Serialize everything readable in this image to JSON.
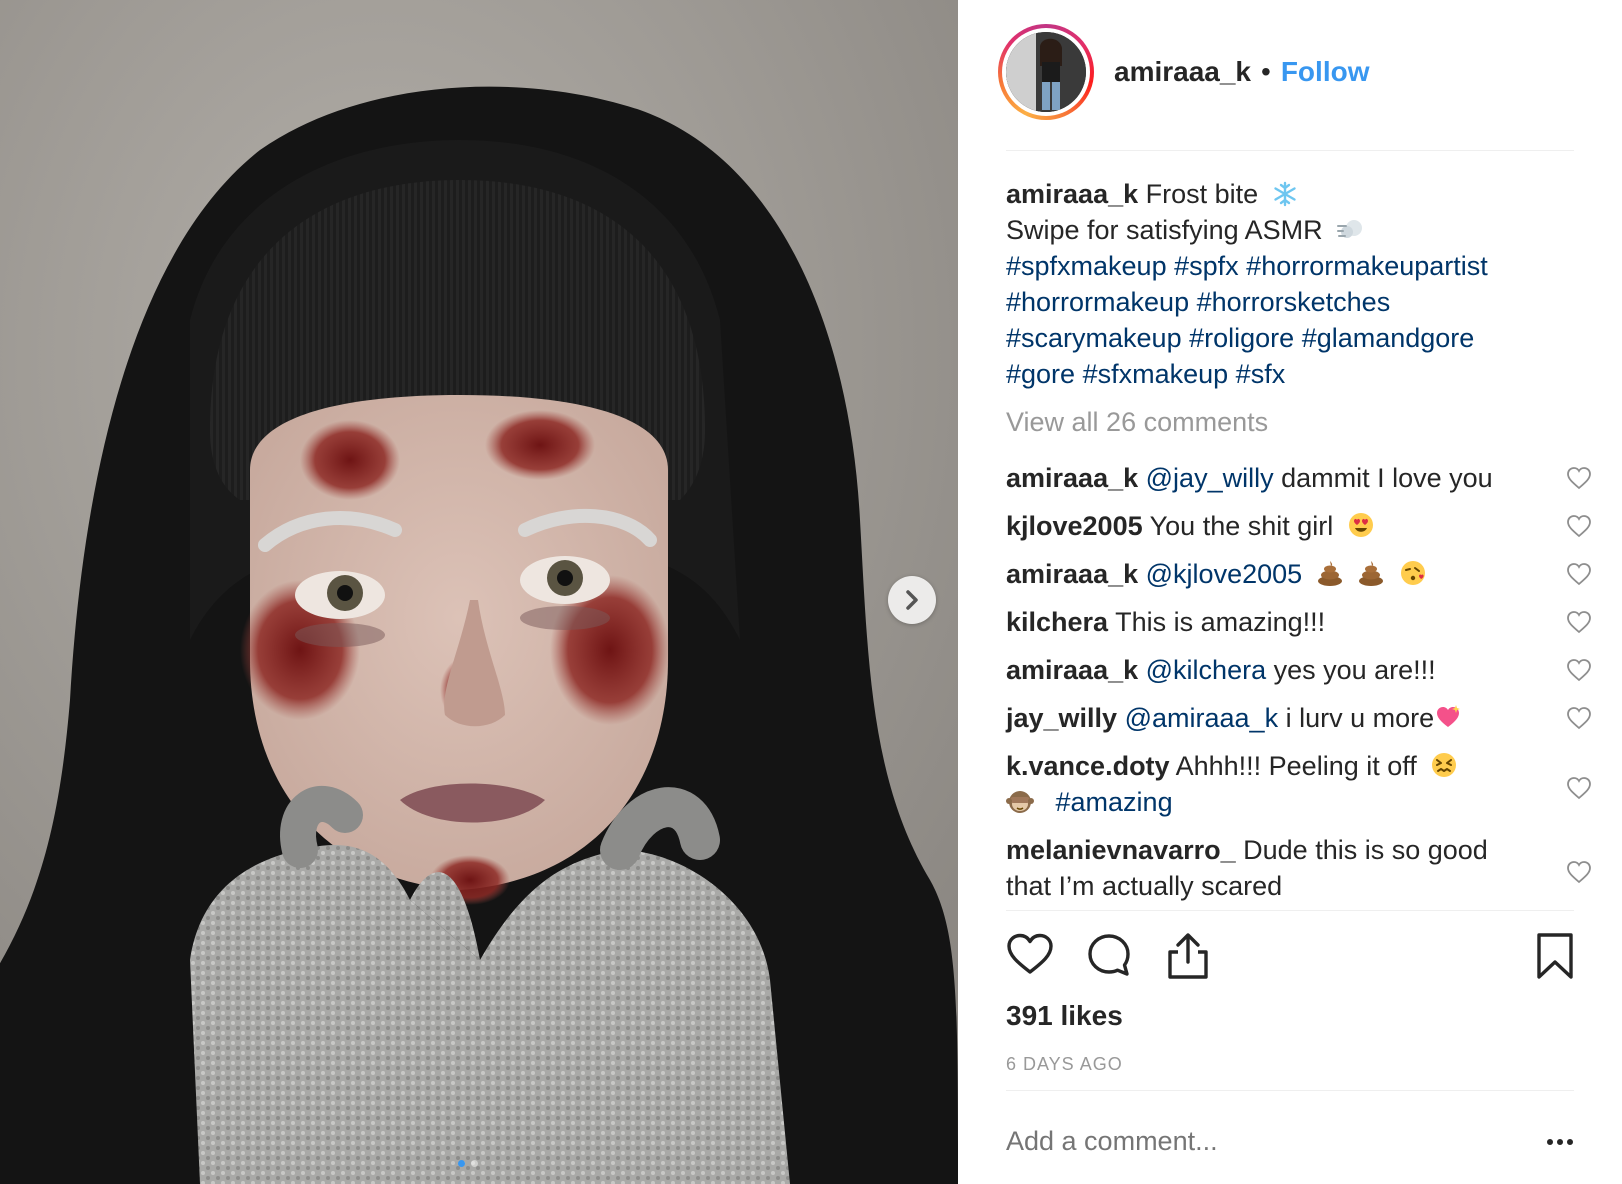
{
  "post": {
    "username": "amiraaa_k",
    "separator": "•",
    "follow_label": "Follow",
    "caption": {
      "username": "amiraaa_k",
      "line1": "Frost bite",
      "line2": "Swipe for satisfying ASMR",
      "hashtags": [
        "#spfxmakeup",
        "#spfx",
        "#horrormakeupartist",
        "#horrormakeup",
        "#horrorsketches",
        "#scarymakeup",
        "#roligore",
        "#glamandgore",
        "#gore",
        "#sfxmakeup",
        "#sfx"
      ]
    },
    "view_all_comments": "View all 26 comments",
    "comments": [
      {
        "user": "amiraaa_k",
        "mention": "@jay_willy",
        "text": "dammit I love you"
      },
      {
        "user": "kjlove2005",
        "mention": "",
        "text": "You the shit girl"
      },
      {
        "user": "amiraaa_k",
        "mention": "@kjlove2005",
        "text": ""
      },
      {
        "user": "kilchera",
        "mention": "",
        "text": "This is amazing!!!"
      },
      {
        "user": "amiraaa_k",
        "mention": "@kilchera",
        "text": "yes you are!!!"
      },
      {
        "user": "jay_willy",
        "mention": "@amiraaa_k",
        "text": "i lurv u more"
      },
      {
        "user": "k.vance.doty",
        "mention": "",
        "text": "Ahhh!!! Peeling it off",
        "tag": "#amazing"
      },
      {
        "user": "melanievnavarro_",
        "mention": "",
        "text": "Dude this is so good",
        "text2": "that I’m actually scared"
      }
    ],
    "likes": "391 likes",
    "timestamp": "6 DAYS AGO",
    "add_comment_placeholder": "Add a comment...",
    "more_label": "•••"
  },
  "icons": {
    "next": "chevron-right-icon",
    "like": "heart-icon",
    "comment": "comment-bubble-icon",
    "share": "share-icon",
    "save": "bookmark-icon"
  },
  "colors": {
    "link": "#3897f0",
    "hashtag": "#003569",
    "muted": "#999999",
    "text": "#262626"
  }
}
